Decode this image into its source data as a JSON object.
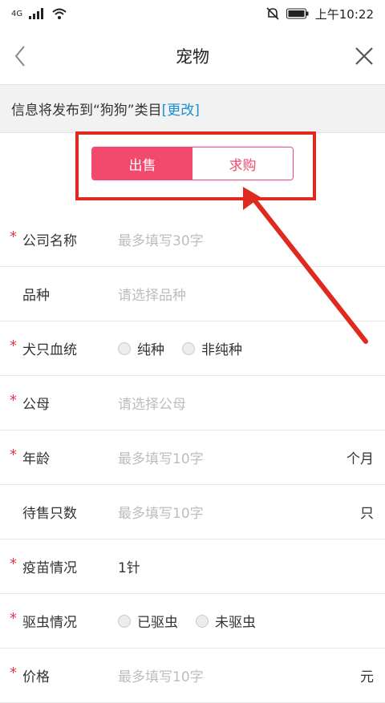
{
  "status_bar": {
    "network": "4G",
    "time": "上午10:22"
  },
  "nav": {
    "title": "宠物"
  },
  "info": {
    "text": "信息将发布到“狗狗”类目",
    "link": "[更改]"
  },
  "toggle": {
    "sell": "出售",
    "buy": "求购",
    "selected": "出售"
  },
  "form": {
    "company": {
      "label": "公司名称",
      "placeholder": "最多填写30字",
      "required": "*"
    },
    "breed": {
      "label": "品种",
      "placeholder": "请选择品种"
    },
    "lineage": {
      "label": "犬只血统",
      "required": "*",
      "options": [
        "纯种",
        "非纯种"
      ]
    },
    "gender": {
      "label": "公母",
      "placeholder": "请选择公母",
      "required": "*"
    },
    "age": {
      "label": "年龄",
      "placeholder": "最多填写10字",
      "unit": "个月",
      "required": "*"
    },
    "count": {
      "label": "待售只数",
      "placeholder": "最多填写10字",
      "unit": "只"
    },
    "vaccine": {
      "label": "疫苗情况",
      "value": "1针",
      "required": "*"
    },
    "deworm": {
      "label": "驱虫情况",
      "required": "*",
      "options": [
        "已驱虫",
        "未驱虫"
      ]
    },
    "price": {
      "label": "价格",
      "placeholder": "最多填写10字",
      "unit": "元",
      "required": "*"
    }
  },
  "colors": {
    "accent": "#f24a6d",
    "annotation": "#e02a1f",
    "link": "#1b8fd6"
  }
}
